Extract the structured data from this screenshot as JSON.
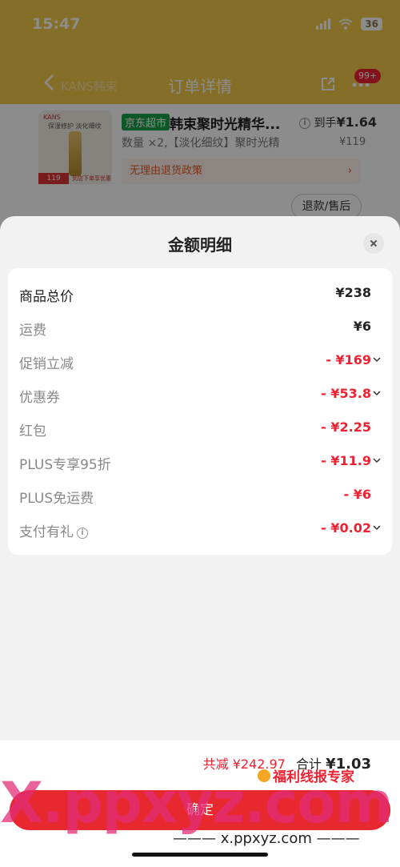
{
  "status_bar": {
    "time": "15:47",
    "battery": "36"
  },
  "background": {
    "nav_title": "订单详情",
    "nav_shop": "KANS韩束",
    "badge": "99+",
    "product": {
      "img_brand": "KANS",
      "img_tag": "保湿修护 淡化细纹",
      "img_price": "119",
      "img_promo": "到店下单享优惠",
      "store_tag": "京东超市",
      "name": "韩束聚时光精华...",
      "final_label": "到手",
      "final_price": "¥1.64",
      "qty": "数量 ×2,【淡化细纹】聚时光精",
      "unit_price": "¥119",
      "return_policy": "无理由退货政策",
      "refund_button": "退款/售后"
    }
  },
  "sheet": {
    "title": "金额明细",
    "rows": [
      {
        "label": "商品总价",
        "value": "¥238"
      },
      {
        "label": "运费",
        "value": "¥6"
      },
      {
        "label": "促销立减",
        "value": "- ¥169"
      },
      {
        "label": "优惠券",
        "value": "- ¥53.8"
      },
      {
        "label": "红包",
        "value": "- ¥2.25"
      },
      {
        "label": "PLUS专享95折",
        "value": "- ¥11.9"
      },
      {
        "label": "PLUS免运费",
        "value": "- ¥6"
      },
      {
        "label": "支付有礼",
        "value": "- ¥0.02"
      }
    ],
    "footer": {
      "saved_label": "共减",
      "saved_value": "¥242.97",
      "total_label": "合计",
      "total_value": "¥1.03",
      "confirm_button": "确定"
    }
  },
  "watermark": {
    "big": "X.ppxyz.com",
    "small": "福利线报专家",
    "url": "——— x.ppxyz.com ———"
  },
  "colors": {
    "accent_red": "#e8282f",
    "header_yellow": "#f3c84a",
    "store_green": "#1aa04a"
  }
}
